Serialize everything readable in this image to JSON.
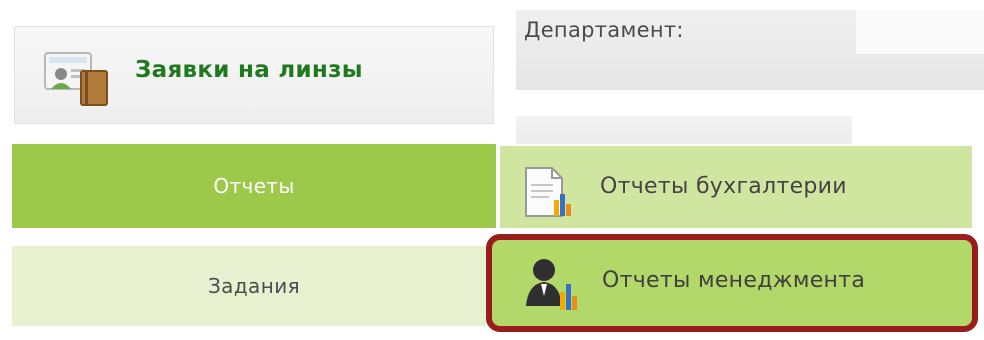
{
  "top_tile": {
    "label": "Заявки на линзы",
    "icon": "contact-card-book-icon"
  },
  "department": {
    "label": "Департамент:"
  },
  "left_nav": {
    "reports_label": "Отчеты",
    "tasks_label": "Задания"
  },
  "reports_submenu": {
    "items": [
      {
        "label": "Отчеты бухгалтерии",
        "icon": "document-bar-chart-icon"
      },
      {
        "label": "Отчеты менеджмента",
        "icon": "manager-bar-chart-icon"
      }
    ]
  },
  "colors": {
    "nav_active": "#9dc94b",
    "nav_inactive": "#e7f1cf",
    "submenu": "#d0e5a0",
    "submenu_highlight": "#b3d86a",
    "highlight_border": "#9a1d1d",
    "title_green": "#1f7a1f"
  }
}
